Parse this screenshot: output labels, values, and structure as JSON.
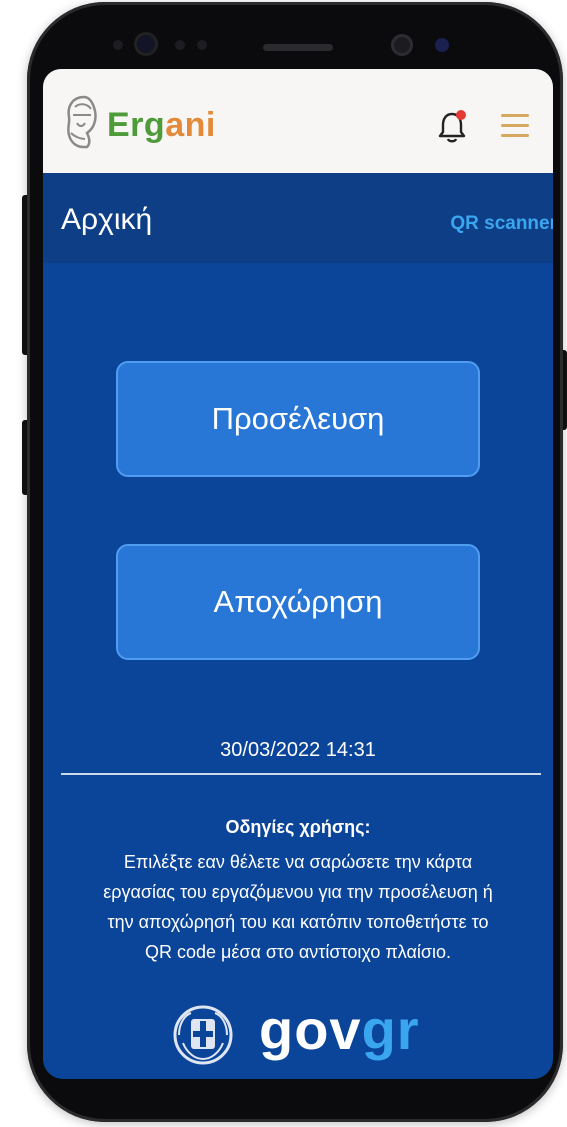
{
  "header": {
    "brand_part1": "Erg",
    "brand_part2": "ani"
  },
  "page": {
    "title": "Αρχική",
    "qr_link": "QR scanner"
  },
  "actions": {
    "arrival_label": "Προσέλευση",
    "departure_label": "Αποχώρηση"
  },
  "status": {
    "datetime": "30/03/2022 14:31"
  },
  "help": {
    "title": "Οδηγίες χρήσης:",
    "line1": "Επιλέξτε εαν θέλετε να σαρώσετε την κάρτα",
    "line2": "εργασίας του εργαζόμενου για την προσέλευση ή",
    "line3": "την αποχώρησή του και κατόπιν τοποθετήστε το",
    "line4": "QR code μέσα στο αντίστοιχο πλαίσιο."
  },
  "footer": {
    "gov": "gov",
    "gr": "gr"
  },
  "colors": {
    "screen_bg": "#0b4599",
    "button_bg": "#2877d6",
    "accent": "#3aa6f0",
    "brand_green": "#4f9b3a",
    "brand_orange": "#e28a3a"
  },
  "icons": [
    "bell-notification-icon",
    "hamburger-menu-icon",
    "ergani-logo-icon",
    "greek-emblem-icon"
  ]
}
